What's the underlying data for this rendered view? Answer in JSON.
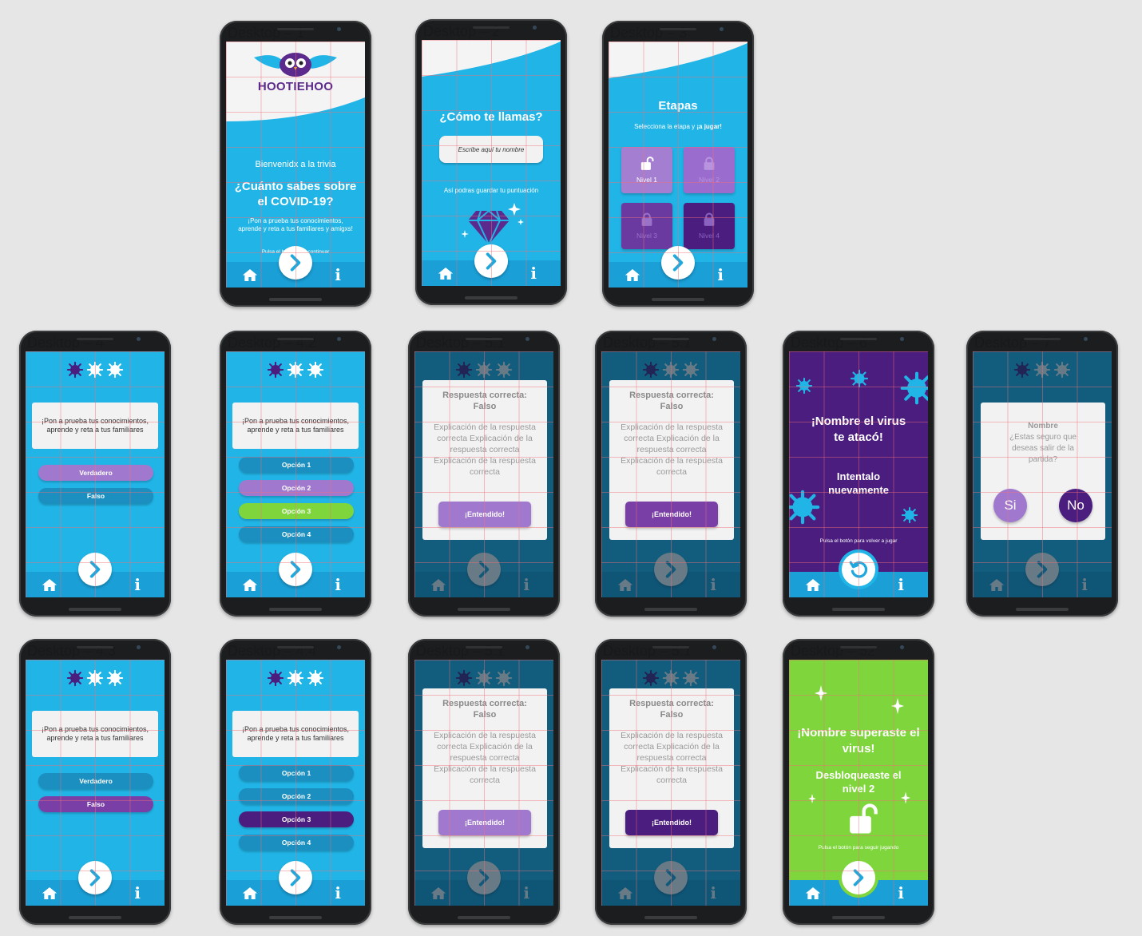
{
  "frames": {
    "f1": "Desktop – 1",
    "f2": "Desktop – 2",
    "f3": "Desktop – 3",
    "f4": "Desktop – 4",
    "f5": "Desktop – 4.2",
    "f6": "Desktop – 5.1",
    "f7": "Desktop – 5.1",
    "f8": "Desktop – 6",
    "f9": "Desktop – 7",
    "f10": "Desktop – 4.3",
    "f11": "Desktop – 4.4",
    "f12": "Desktop – 5.1",
    "f13": "Desktop – 5.1",
    "f14": "Desktop – 52"
  },
  "welcome": {
    "logo_text": "HOOTIEHOO",
    "greeting": "Bienvenidx a la trivia",
    "title": "¿Cuánto sabes sobre el COVID-19?",
    "subtitle": "¡Pon a prueba tus conocimientos, aprende y reta a tus familiares y amigxs!",
    "hint": "Pulsa el botón para continuar"
  },
  "name_screen": {
    "title": "¿Cómo te llamas?",
    "input_placeholder": "Escribe aquí tu nombre",
    "note": "Así podras guardar tu puntuación"
  },
  "stages": {
    "title": "Etapas",
    "subtitle": "Selecciona la etapa y ",
    "subtitle_bold": "¡a jugar!",
    "levels": [
      "Nivel 1",
      "Nivel 2",
      "Nivel 3",
      "Nivel 4"
    ]
  },
  "question": {
    "text": "¡Pon a prueba tus conocimientos, aprende y reta a tus familiares",
    "true_label": "Verdadero",
    "false_label": "Falso",
    "options": [
      "Opción 1",
      "Opción 2",
      "Opción 3",
      "Opción 4"
    ]
  },
  "answer_modal": {
    "title": "Respuesta correcta: Falso",
    "body": "Explicación de la respuesta correcta Explicación de la respuesta correcta Explicación de la respuesta correcta",
    "button": "¡Entendido!"
  },
  "lose": {
    "title": "¡Nombre el virus te atacó!",
    "retry": "Intentalo nuevamente",
    "hint": "Pulsa el botón para volver a jugar"
  },
  "exit_modal": {
    "name": "Nombre",
    "question": "¿Estas seguro que deseas salir de la partida?",
    "yes": "Si",
    "no": "No"
  },
  "win": {
    "title": "¡Nombre superaste el virus!",
    "unlock": "Desbloqueaste el nivel 2",
    "hint": "Pulsa el botón para seguir jugando"
  },
  "colors": {
    "blue": "#21b4e6",
    "nav_blue": "#1a9fd6",
    "purple": "#4a1d7f",
    "lavender": "#a079cf",
    "green": "#7fd63c"
  }
}
